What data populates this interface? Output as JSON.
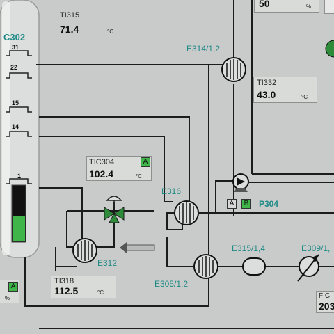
{
  "column": {
    "name": "C302",
    "trays": [
      "31",
      "22",
      "15",
      "14",
      "1"
    ],
    "level_fraction": 0.45,
    "accent": "#3fb54a"
  },
  "ti315": {
    "tag": "TI315",
    "value": "71.4",
    "unit": "°C"
  },
  "ti332": {
    "tag": "TI332",
    "value": "43.0",
    "unit": "°C"
  },
  "tic304": {
    "tag": "TIC304",
    "value": "102.4",
    "unit": "°C",
    "mode": "A"
  },
  "ti318": {
    "tag": "TI318",
    "value": "112.5",
    "unit": "°C"
  },
  "top_display": {
    "value": "50",
    "unit": "%"
  },
  "left_display": {
    "mode": "A",
    "unit": "%"
  },
  "fic_display": {
    "tag": "FIC",
    "value": "203"
  },
  "exchangers": {
    "e314": "E314/1,2",
    "e316": "E316",
    "e312": "E312",
    "e305": "E305/1,2",
    "e315": "E315/1,4",
    "e309": "E309/1,"
  },
  "pump": {
    "tag": "P304",
    "mode_a": "A",
    "mode_b": "B"
  }
}
